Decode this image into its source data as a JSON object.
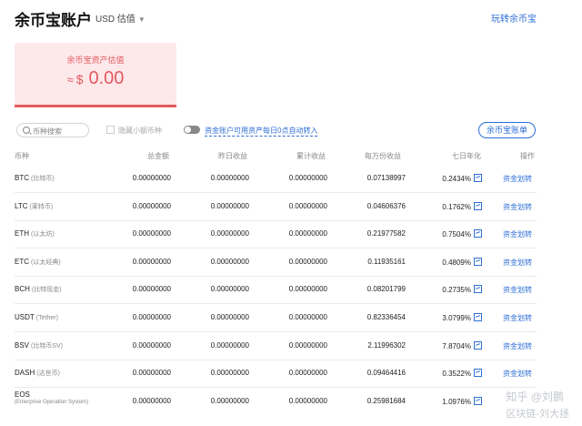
{
  "header": {
    "title": "余币宝账户",
    "currency": "USD 估值",
    "top_link": "玩转余币宝"
  },
  "summary": {
    "label": "余币宝资产估值",
    "approx": "≈",
    "symbol": "$",
    "value": "0.00"
  },
  "filters": {
    "search_placeholder": "币种搜索",
    "hide_small": "隐藏小额币种",
    "auto_transfer": "资金账户可用资产每日0点自动转入",
    "statement_button": "余币宝账单"
  },
  "table": {
    "headers": [
      "币种",
      "总金额",
      "昨日收益",
      "累计收益",
      "每万份收益",
      "七日年化",
      "操作"
    ],
    "rows": [
      {
        "coin": "BTC",
        "sub": "(比特币)",
        "total": "0.00000000",
        "yesterday": "0.00000000",
        "cumulative": "0.00000000",
        "per10k": "0.07138997",
        "apy": "0.2434%",
        "action": "资金划转"
      },
      {
        "coin": "LTC",
        "sub": "(莱特币)",
        "total": "0.00000000",
        "yesterday": "0.00000000",
        "cumulative": "0.00000000",
        "per10k": "0.04606376",
        "apy": "0.1762%",
        "action": "资金划转"
      },
      {
        "coin": "ETH",
        "sub": "(以太坊)",
        "total": "0.00000000",
        "yesterday": "0.00000000",
        "cumulative": "0.00000000",
        "per10k": "0.21977582",
        "apy": "0.7504%",
        "action": "资金划转"
      },
      {
        "coin": "ETC",
        "sub": "(以太经典)",
        "total": "0.00000000",
        "yesterday": "0.00000000",
        "cumulative": "0.00000000",
        "per10k": "0.11935161",
        "apy": "0.4809%",
        "action": "资金划转"
      },
      {
        "coin": "BCH",
        "sub": "(比特现金)",
        "total": "0.00000000",
        "yesterday": "0.00000000",
        "cumulative": "0.00000000",
        "per10k": "0.08201799",
        "apy": "0.2735%",
        "action": "资金划转"
      },
      {
        "coin": "USDT",
        "sub": "(Tether)",
        "total": "0.00000000",
        "yesterday": "0.00000000",
        "cumulative": "0.00000000",
        "per10k": "0.82336454",
        "apy": "3.0799%",
        "action": "资金划转"
      },
      {
        "coin": "BSV",
        "sub": "(比特币SV)",
        "total": "0.00000000",
        "yesterday": "0.00000000",
        "cumulative": "0.00000000",
        "per10k": "2.11996302",
        "apy": "7.8704%",
        "action": "资金划转"
      },
      {
        "coin": "DASH",
        "sub": "(达世币)",
        "total": "0.00000000",
        "yesterday": "0.00000000",
        "cumulative": "0.00000000",
        "per10k": "0.09464416",
        "apy": "0.3522%",
        "action": "资金划转"
      }
    ],
    "last_row": {
      "coin": "EOS",
      "sub": "(Enterprise Operation System)",
      "total": "0.00000000",
      "yesterday": "0.00000000",
      "cumulative": "0.00000000",
      "per10k": "0.25981684",
      "apy": "1.0976%"
    }
  },
  "watermark": {
    "line1": "知乎 @刘鹏",
    "line2": "区块链-刘大拯"
  },
  "colors": {
    "accent": "#2e6fd6",
    "card_bg": "#fde8ea",
    "card_accent": "#e35a5f"
  }
}
